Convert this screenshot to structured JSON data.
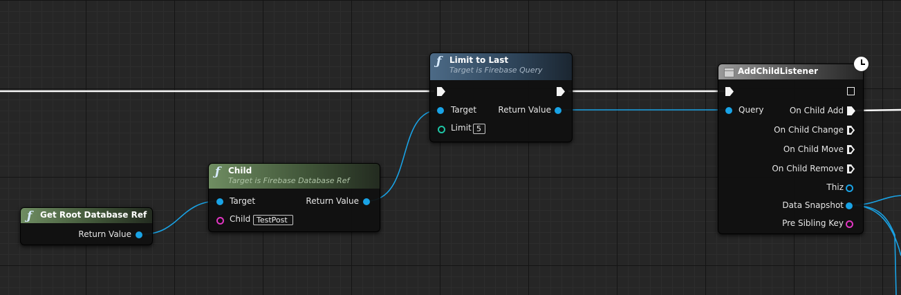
{
  "nodes": {
    "get_root": {
      "title": "Get Root Database Ref",
      "outputs": {
        "return_value": "Return Value"
      }
    },
    "child": {
      "title": "Child",
      "subtitle": "Target is Firebase Database Ref",
      "inputs": {
        "target": "Target",
        "child": "Child",
        "child_value": "TestPost"
      },
      "outputs": {
        "return_value": "Return Value"
      }
    },
    "limit_to_last": {
      "title": "Limit to Last",
      "subtitle": "Target is Firebase Query",
      "inputs": {
        "target": "Target",
        "limit": "Limit",
        "limit_value": "5"
      },
      "outputs": {
        "return_value": "Return Value"
      }
    },
    "add_child_listener": {
      "title": "AddChildListener",
      "inputs": {
        "query": "Query"
      },
      "outputs": {
        "on_child_add": "On Child Add",
        "on_child_change": "On Child Change",
        "on_child_move": "On Child Move",
        "on_child_remove": "On Child Remove",
        "thiz": "Thiz",
        "data_snapshot": "Data Snapshot",
        "pre_sibling_key": "Pre Sibling Key"
      }
    }
  },
  "colors": {
    "object_pin": "#19a3e6",
    "int_pin": "#1ec6a6",
    "string_pin": "#e236c3",
    "exec_wire": "#ffffff",
    "header_pure": "#6f8d62",
    "header_function": "#4c6a86",
    "header_latent": "#9a9a9a"
  },
  "icons": {
    "function": "function-f-icon",
    "latent": "clock-icon",
    "macro": "box-icon"
  }
}
